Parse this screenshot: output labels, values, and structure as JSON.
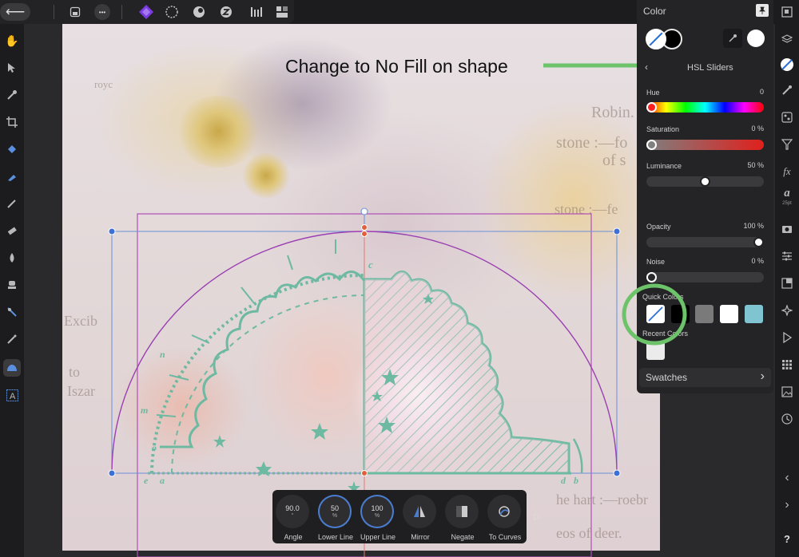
{
  "top_bar": {
    "back_icon": "arrow-left-icon",
    "items": [
      {
        "name": "document-icon"
      },
      {
        "name": "more-icon",
        "glyph": "•••"
      },
      {
        "name": "designer-persona-icon"
      },
      {
        "name": "pixel-persona-icon"
      },
      {
        "name": "export-persona-icon"
      },
      {
        "name": "stock-persona-icon"
      },
      {
        "name": "align-icon"
      },
      {
        "name": "arrange-icon"
      }
    ]
  },
  "left_tools": [
    "hand-tool-icon",
    "move-tool-icon",
    "color-picker-tool-icon",
    "crop-tool-icon",
    "fill-tool-icon",
    "pen-tool-icon",
    "brush-tool-icon",
    "eraser-tool-icon",
    "smudge-tool-icon",
    "clone-tool-icon",
    "node-tool-icon",
    "vector-brush-icon",
    "shape-tool-icon",
    "text-tool-icon"
  ],
  "right_tools": [
    "navigator-icon",
    "layers-icon",
    "color-icon",
    "brush-icon",
    "assets-icon",
    "transparency-icon",
    "fx-icon",
    "text-styles-icon",
    "stock-icon",
    "adjustments-icon",
    "transform-icon",
    "symbols-icon",
    "history-play-icon",
    "swatches-grid-icon",
    "photo-icon",
    "clock-icon",
    "collapse-left-icon",
    "expand-right-icon",
    "help-icon"
  ],
  "right_tool_text": {
    "fx": "fx",
    "text_style": "a",
    "text_size": "25pt",
    "help": "?"
  },
  "color_panel": {
    "title": "Color",
    "mode": "HSL Sliders",
    "hue": {
      "label": "Hue",
      "value": "0"
    },
    "saturation": {
      "label": "Saturation",
      "value": "0 %"
    },
    "luminance": {
      "label": "Luminance",
      "value": "50 %"
    },
    "opacity": {
      "label": "Opacity",
      "value": "100 %"
    },
    "noise": {
      "label": "Noise",
      "value": "0 %"
    },
    "quick_colors_label": "Quick Colors",
    "quick_colors": [
      "none",
      "#000000",
      "#7a7a7a",
      "#ffffff",
      "#7fc4d0"
    ],
    "recent_colors_label": "Recent Colors",
    "recent_colors": [
      "#ebebeb"
    ],
    "swatches_label": "Swatches"
  },
  "annotation": {
    "text": "Change to No Fill on shape",
    "color": "#6cc36a"
  },
  "context_toolbar": {
    "items": [
      {
        "value": "90.0",
        "unit": "°",
        "label": "Angle"
      },
      {
        "value": "50",
        "unit": "%",
        "label": "Lower Line"
      },
      {
        "value": "100",
        "unit": "%",
        "label": "Upper Line"
      },
      {
        "value": "",
        "unit": "",
        "label": "Mirror"
      },
      {
        "value": "",
        "unit": "",
        "label": "Negate"
      },
      {
        "value": "",
        "unit": "",
        "label": "To Curves"
      }
    ],
    "more_glyph": "▷"
  },
  "canvas": {
    "background_text": [
      "royc",
      "Robin.",
      "stone :—fo",
      "of s",
      "stone :—fe",
      "Excib",
      "to",
      "Iszar",
      "he hart :—roebr",
      "eos of deer."
    ],
    "shape_letters": [
      "c",
      "n",
      "m",
      "o",
      "e",
      "a",
      "d",
      "b"
    ]
  }
}
